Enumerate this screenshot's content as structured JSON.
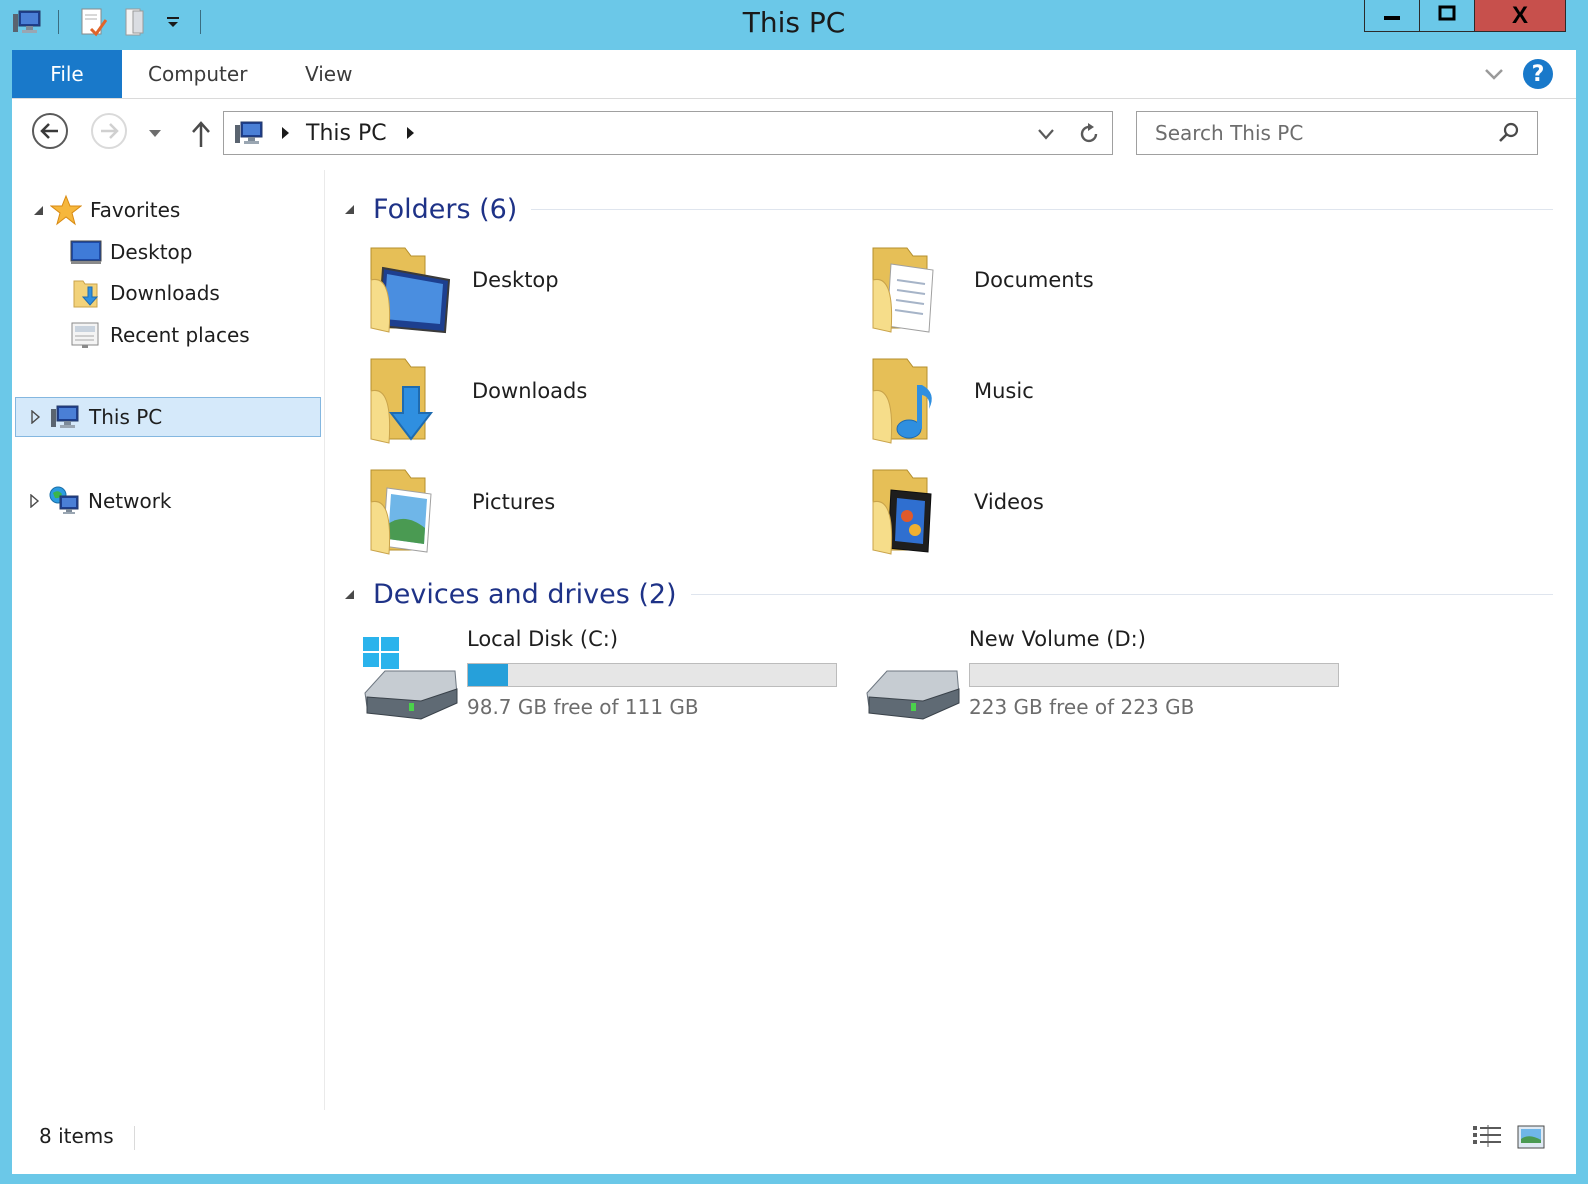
{
  "window": {
    "title": "This PC",
    "controls": {
      "minimize": "minimize-icon",
      "maximize": "maximize-icon",
      "close": "close-icon"
    },
    "close_glyph": "X"
  },
  "quick_access": [
    "computer-icon",
    "properties-icon",
    "new-folder-icon",
    "customize-chevron-icon"
  ],
  "ribbon": {
    "tabs": [
      {
        "label": "File",
        "active": true
      },
      {
        "label": "Computer"
      },
      {
        "label": "View"
      }
    ],
    "help_glyph": "?"
  },
  "nav": {
    "address": {
      "segments": [
        "This PC"
      ]
    },
    "search": {
      "placeholder": "Search This PC",
      "value": ""
    }
  },
  "sidebar": {
    "favorites": {
      "label": "Favorites",
      "items": [
        {
          "label": "Desktop"
        },
        {
          "label": "Downloads"
        },
        {
          "label": "Recent places"
        }
      ]
    },
    "this_pc": {
      "label": "This PC",
      "selected": true
    },
    "network": {
      "label": "Network"
    }
  },
  "main": {
    "folders": {
      "header": "Folders (6)",
      "items": [
        {
          "label": "Desktop",
          "icon": "desktop-folder-icon"
        },
        {
          "label": "Documents",
          "icon": "documents-folder-icon"
        },
        {
          "label": "Downloads",
          "icon": "downloads-folder-icon"
        },
        {
          "label": "Music",
          "icon": "music-folder-icon"
        },
        {
          "label": "Pictures",
          "icon": "pictures-folder-icon"
        },
        {
          "label": "Videos",
          "icon": "videos-folder-icon"
        }
      ]
    },
    "drives": {
      "header": "Devices and drives (2)",
      "items": [
        {
          "label": "Local Disk (C:)",
          "free_text": "98.7 GB free of 111 GB",
          "used_fraction": 0.11,
          "icon": "windows-drive-icon"
        },
        {
          "label": "New Volume (D:)",
          "free_text": "223 GB free of 223 GB",
          "used_fraction": 0.0,
          "icon": "hard-drive-icon"
        }
      ]
    }
  },
  "status": {
    "count": "8 items"
  },
  "colors": {
    "title_bar": "#6bc8e8",
    "file_tab": "#1979ca",
    "group_header_text": "#1e3287",
    "selection_bg": "#d5e9fa",
    "selection_border": "#84b7e0",
    "drive_bar_fill": "#26a0da",
    "close_button": "#c7504c"
  }
}
